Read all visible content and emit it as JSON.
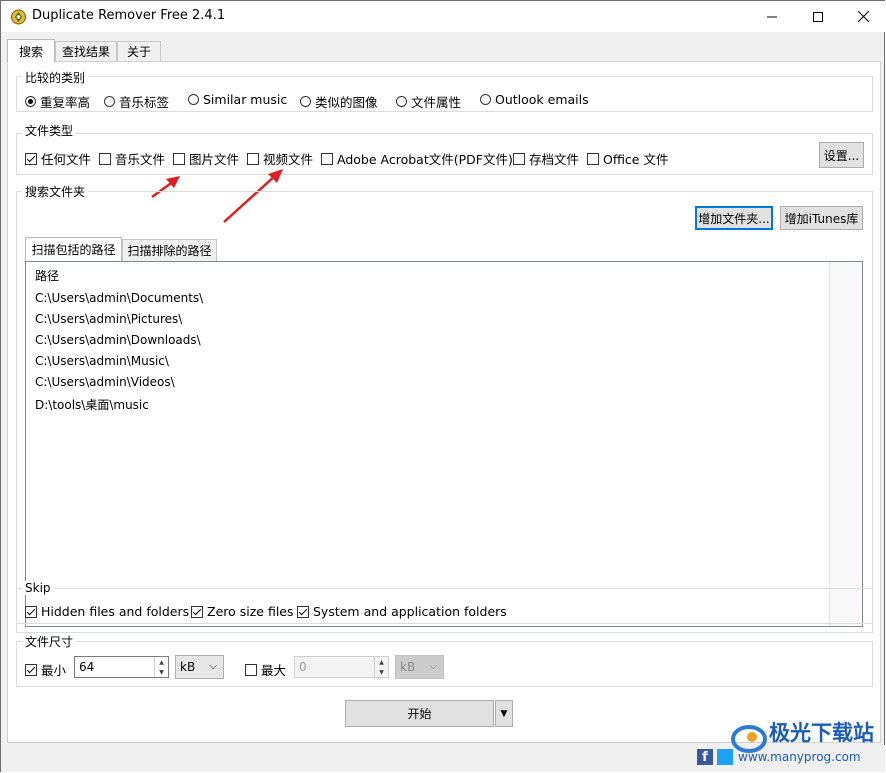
{
  "window": {
    "title": "Duplicate Remover Free 2.4.1"
  },
  "tabs": [
    "搜索",
    "查找结果",
    "关于"
  ],
  "compare": {
    "label": "比较的类别",
    "options": [
      "重复率高",
      "音乐标签",
      "Similar music",
      "类似的图像",
      "文件属性",
      "Outlook emails"
    ],
    "selected": "重复率高"
  },
  "filetypes": {
    "label": "文件类型",
    "items": [
      {
        "label": "任何文件",
        "checked": true
      },
      {
        "label": "音乐文件",
        "checked": false
      },
      {
        "label": "图片文件",
        "checked": false
      },
      {
        "label": "视频文件",
        "checked": false
      },
      {
        "label": "Adobe Acrobat文件(PDF文件)",
        "checked": false
      },
      {
        "label": "存档文件",
        "checked": false
      },
      {
        "label": "Office 文件",
        "checked": false
      }
    ],
    "settings_button": "设置..."
  },
  "folders": {
    "label": "搜索文件夹",
    "add_folder_button": "增加文件夹...",
    "add_itunes_button": "增加iTunes库",
    "subtabs": [
      "扫描包括的路径",
      "扫描排除的路径"
    ],
    "column_header": "路径",
    "paths": [
      "C:\\Users\\admin\\Documents\\",
      "C:\\Users\\admin\\Pictures\\",
      "C:\\Users\\admin\\Downloads\\",
      "C:\\Users\\admin\\Music\\",
      "C:\\Users\\admin\\Videos\\",
      "D:\\tools\\桌面\\music"
    ]
  },
  "skip": {
    "label": "Skip",
    "items": [
      {
        "label": "Hidden files and folders",
        "checked": true
      },
      {
        "label": "Zero size files",
        "checked": true
      },
      {
        "label": "System and application folders",
        "checked": true
      }
    ]
  },
  "filesize": {
    "label": "文件尺寸",
    "min_label": "最小",
    "min_checked": true,
    "min_value": "64",
    "min_unit": "kB",
    "max_label": "最大",
    "max_checked": false,
    "max_value": "0",
    "max_unit": "kB"
  },
  "start_button": "开始",
  "watermark": {
    "site": "极光下载站",
    "url": "www.manyprog.com"
  },
  "colors": {
    "accent": "#0078d7",
    "arrow": "#e02020"
  }
}
